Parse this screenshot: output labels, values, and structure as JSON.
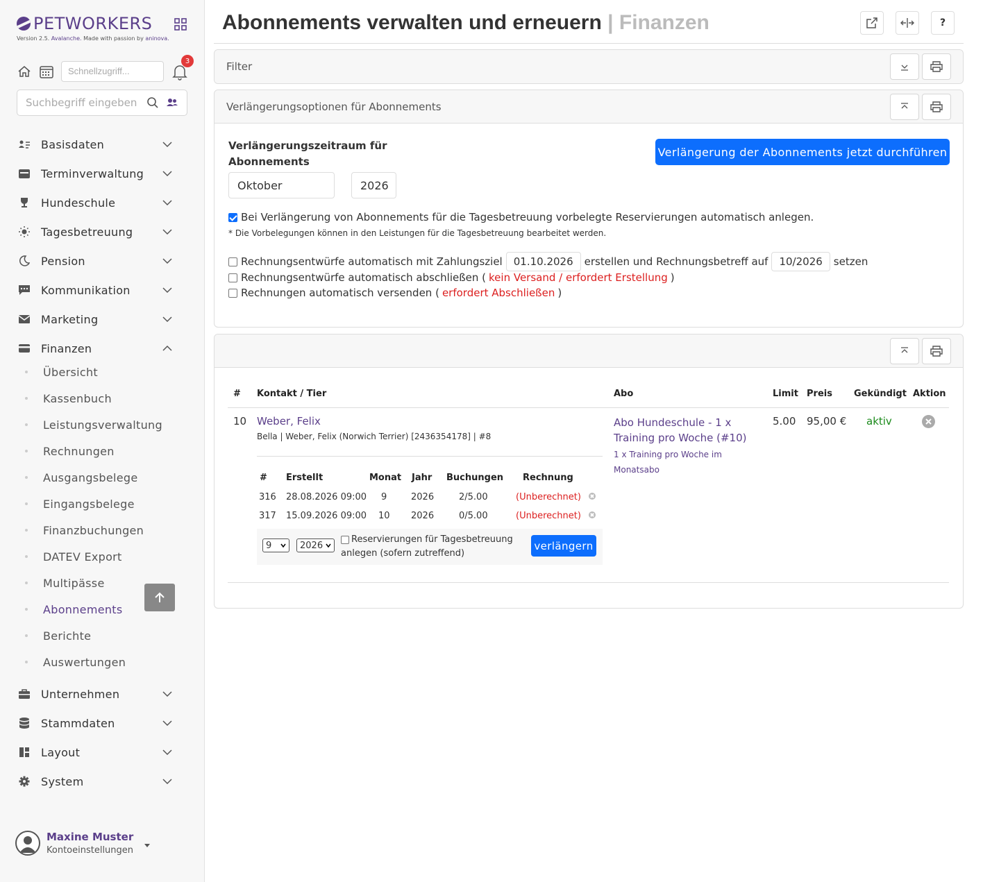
{
  "brand": {
    "name": "PETWORKERS",
    "version_prefix": "Version 2.5.",
    "version_name": "Avalanche.",
    "version_suffix": "Made with passion by",
    "maker": "aninova."
  },
  "quick": {
    "placeholder": "Schnellzugriff...",
    "notification_count": "3"
  },
  "search": {
    "placeholder": "Suchbegriff eingeben"
  },
  "nav": {
    "basisdaten": "Basisdaten",
    "terminverwaltung": "Terminverwaltung",
    "hundeschule": "Hundeschule",
    "tagesbetreuung": "Tagesbetreuung",
    "pension": "Pension",
    "kommunikation": "Kommunikation",
    "marketing": "Marketing",
    "finanzen": "Finanzen",
    "unternehmen": "Unternehmen",
    "stammdaten": "Stammdaten",
    "layout": "Layout",
    "system": "System",
    "finanzen_sub": [
      "Übersicht",
      "Kassenbuch",
      "Leistungsverwaltung",
      "Rechnungen",
      "Ausgangsbelege",
      "Eingangsbelege",
      "Finanzbuchungen",
      "DATEV Export",
      "Multipässe",
      "Abonnements",
      "Berichte",
      "Auswertungen"
    ]
  },
  "user": {
    "name": "Maxine Muster",
    "sub": "Kontoeinstellungen"
  },
  "header": {
    "title": "Abonnements verwalten und erneuern",
    "separator": "|",
    "subtitle": "Finanzen",
    "help": "?"
  },
  "filter": {
    "title": "Filter"
  },
  "options": {
    "title": "Verlängerungsoptionen für Abonnements",
    "period_label_1": "Verlängerungszeitraum für",
    "period_label_2": "Abonnements",
    "month": "Oktober",
    "year": "2026",
    "run_button": "Verlängerung der Abonnements jetzt durchführen",
    "auto_reserve": "Bei Verlängerung von Abonnements für die Tagesbetreuung vorbelegte Reservierungen automatisch anlegen.",
    "note": "* Die Vorbelegungen können in den Leistungen für die Tagesbetreuung bearbeitet werden.",
    "drafts_a": "Rechnungsentwürfe automatisch mit Zahlungsziel",
    "due_date": "01.10.2026",
    "drafts_b": "erstellen und Rechnungsbetreff auf",
    "subject": "10/2026",
    "drafts_c": "setzen",
    "finalize_a": "Rechnungsentwürfe automatisch abschließen (",
    "finalize_red": "kein Versand / erfordert Erstellung",
    "finalize_b": ")",
    "send_a": "Rechnungen automatisch versenden (",
    "send_red": "erfordert Abschließen",
    "send_b": ")"
  },
  "table": {
    "headers": {
      "num": "#",
      "contact": "Kontakt / Tier",
      "abo": "Abo",
      "limit": "Limit",
      "price": "Preis",
      "cancelled": "Gekündigt",
      "action": "Aktion"
    },
    "row": {
      "num": "10",
      "contact": "Weber, Felix",
      "pet": "Bella | Weber, Felix (Norwich Terrier) [2436354178] | #8",
      "abo_1": "Abo Hundeschule - 1 x",
      "abo_2": "Training pro Woche (#10)",
      "abo_desc_1": "1 x Training pro Woche im",
      "abo_desc_2": "Monatsabo",
      "limit": "5.00",
      "price": "95,00 €",
      "status": "aktiv"
    },
    "sub_headers": {
      "num": "#",
      "created": "Erstellt",
      "month": "Monat",
      "year": "Jahr",
      "bookings": "Buchungen",
      "invoice": "Rechnung"
    },
    "sub_rows": [
      {
        "num": "316",
        "created": "28.08.2026 09:00",
        "month": "9",
        "year": "2026",
        "bookings": "2/5.00",
        "invoice": "(Unberechnet)"
      },
      {
        "num": "317",
        "created": "15.09.2026 09:00",
        "month": "10",
        "year": "2026",
        "bookings": "0/5.00",
        "invoice": "(Unberechnet)"
      }
    ],
    "extend": {
      "month": "9",
      "year": "2026",
      "checkbox_1": "Reservierungen für Tagesbetreuung",
      "checkbox_2": "anlegen (sofern zutreffend)",
      "button": "verlängern"
    }
  },
  "colors": {
    "accent": "#5b3f8a",
    "primary": "#0d6efd",
    "danger": "#dc1f1f",
    "success": "#1a8a1a"
  }
}
